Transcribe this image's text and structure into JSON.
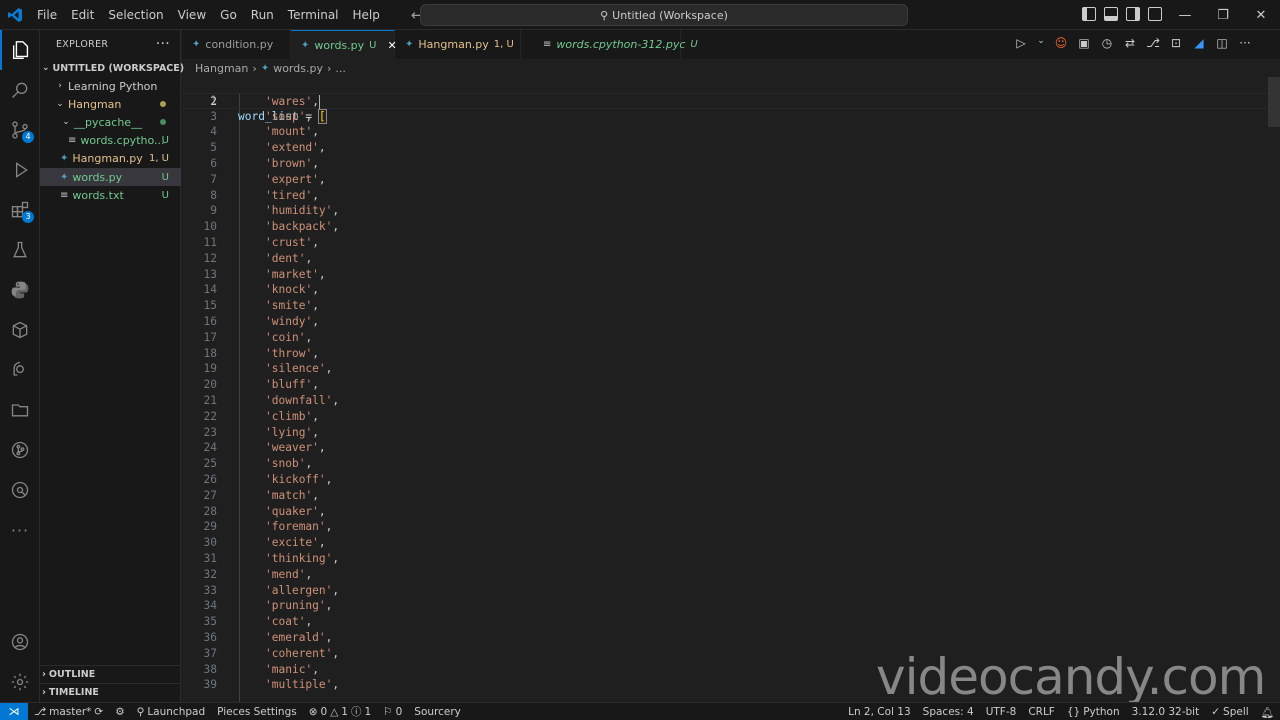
{
  "titlebar": {
    "menu": [
      "File",
      "Edit",
      "Selection",
      "View",
      "Go",
      "Run",
      "Terminal",
      "Help"
    ],
    "search_text": "Untitled (Workspace)"
  },
  "activity_badges": {
    "source_control": "4",
    "extensions": "3"
  },
  "sidebar": {
    "title": "EXPLORER",
    "workspace": "UNTITLED (WORKSPACE)",
    "items": [
      {
        "label": "Learning Python",
        "status": ""
      },
      {
        "label": "Hangman",
        "status": ""
      },
      {
        "label": "__pycache__",
        "status": ""
      },
      {
        "label": "words.cpytho...",
        "status": "U"
      },
      {
        "label": "Hangman.py",
        "status": "1, U"
      },
      {
        "label": "words.py",
        "status": "U"
      },
      {
        "label": "words.txt",
        "status": "U"
      }
    ],
    "outline": "OUTLINE",
    "timeline": "TIMELINE"
  },
  "tabs": [
    {
      "label": "condition.py",
      "mod": ""
    },
    {
      "label": "words.py",
      "mod": "U"
    },
    {
      "label": "Hangman.py",
      "mod": "1, U"
    },
    {
      "label": "words.cpython-312.pyc",
      "mod": "U"
    }
  ],
  "breadcrumb": {
    "folder": "Hangman",
    "file": "words.py",
    "more": "..."
  },
  "editor": {
    "first_line": "word_list",
    "words": [
      "wares",
      "soup",
      "mount",
      "extend",
      "brown",
      "expert",
      "tired",
      "humidity",
      "backpack",
      "crust",
      "dent",
      "market",
      "knock",
      "smite",
      "windy",
      "coin",
      "throw",
      "silence",
      "bluff",
      "downfall",
      "climb",
      "lying",
      "weaver",
      "snob",
      "kickoff",
      "match",
      "quaker",
      "foreman",
      "excite",
      "thinking",
      "mend",
      "allergen",
      "pruning",
      "coat",
      "emerald",
      "coherent",
      "manic",
      "multiple"
    ]
  },
  "statusbar": {
    "branch": "master*",
    "launchpad": "Launchpad",
    "pieces": "Pieces Settings",
    "errors": "0",
    "warnings": "1",
    "info": "1",
    "ports": "0",
    "sourcery": "Sourcery",
    "position": "Ln 2, Col 13",
    "spaces": "Spaces: 4",
    "encoding": "UTF-8",
    "eol": "CRLF",
    "language": "Python",
    "interpreter": "3.12.0 32-bit",
    "spell": "Spell"
  },
  "watermark": "videocandy.com",
  "colors": {
    "accent": "#0078d4",
    "untracked": "#73c991",
    "modified": "#e2c08d",
    "string": "#ce9178"
  }
}
